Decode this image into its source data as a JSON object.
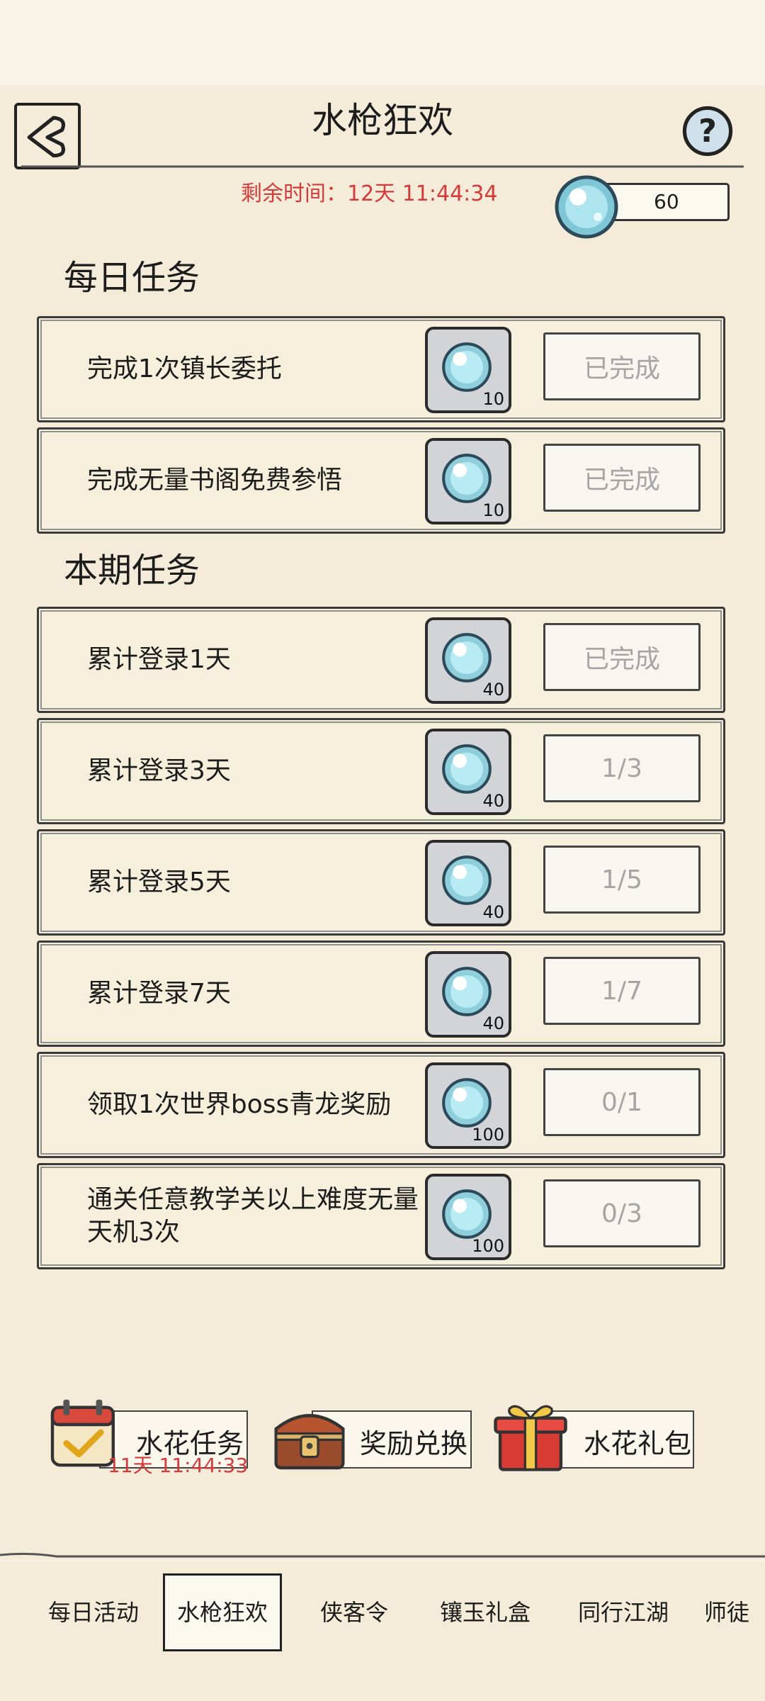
{
  "header": {
    "title": "水枪狂欢",
    "back_icon": "back-arrow-icon",
    "help_icon": "help-icon"
  },
  "event": {
    "countdown_label": "剩余时间：",
    "countdown_value": "12天 11:44:34",
    "currency_amount": "60",
    "currency_icon": "water-orb-icon"
  },
  "sections": {
    "daily": {
      "title": "每日任务",
      "tasks": [
        {
          "label": "完成1次镇长委托",
          "reward": "10",
          "status": "已完成"
        },
        {
          "label": "完成无量书阁免费参悟",
          "reward": "10",
          "status": "已完成"
        }
      ]
    },
    "period": {
      "title": "本期任务",
      "tasks": [
        {
          "label": "累计登录1天",
          "reward": "40",
          "status": "已完成"
        },
        {
          "label": "累计登录3天",
          "reward": "40",
          "status": "1/3"
        },
        {
          "label": "累计登录5天",
          "reward": "40",
          "status": "1/5"
        },
        {
          "label": "累计登录7天",
          "reward": "40",
          "status": "1/7"
        },
        {
          "label": "领取1次世界boss青龙奖励",
          "reward": "100",
          "status": "0/1"
        },
        {
          "label": "通关任意教学关以上难度无量天机3次",
          "reward": "100",
          "status": "0/3"
        }
      ]
    }
  },
  "shortcuts": [
    {
      "label": "水花任务",
      "timer": "11天 11:44:33",
      "icon": "calendar-check-icon"
    },
    {
      "label": "奖励兑换",
      "icon": "treasure-chest-icon"
    },
    {
      "label": "水花礼包",
      "icon": "gift-box-icon"
    }
  ],
  "bottom_nav": [
    "每日活动",
    "水枪狂欢",
    "侠客令",
    "镶玉礼盒",
    "同行江湖",
    "师徒"
  ],
  "colors": {
    "background": "#f4ecd8",
    "timer_red": "#d33b3b",
    "reward_box": "#d3d4d8",
    "status_text": "#a5a5a5"
  }
}
